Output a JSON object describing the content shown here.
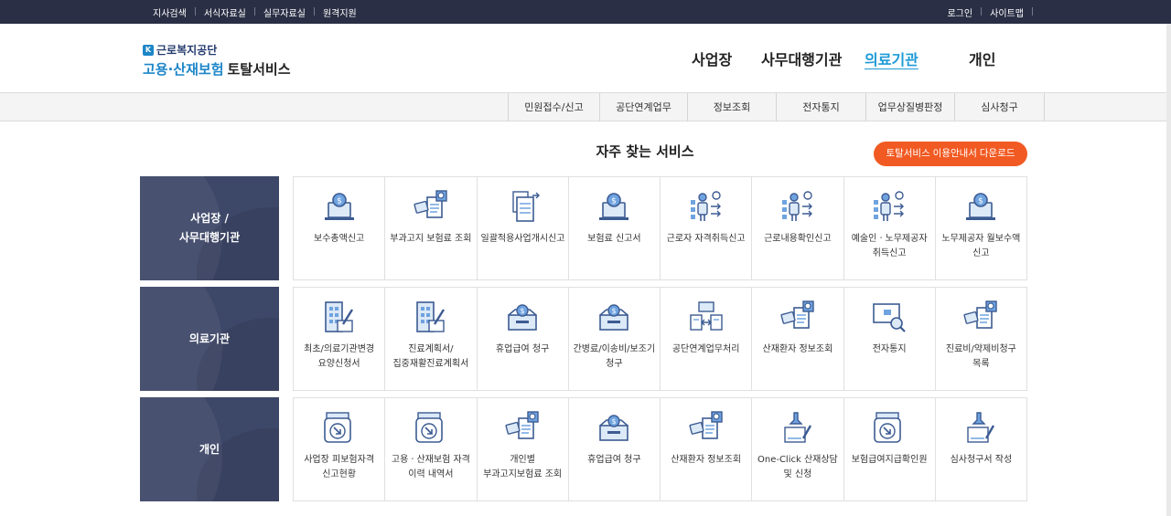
{
  "topbar": {
    "left_links": [
      "지사검색",
      "서식자료실",
      "실무자료실",
      "원격지원"
    ],
    "right_links": [
      "로그인",
      "사이트맵"
    ],
    "separator": "|"
  },
  "logo": {
    "org": "근로복지공단",
    "name_colored": "고용·산재보험",
    "name_dark": "토탈서비스"
  },
  "gnb": [
    "사업장",
    "사무대행기관",
    "의료기관",
    "개인"
  ],
  "gnb_active_index": 2,
  "submenu": [
    "민원접수/신고",
    "공단연계업무",
    "정보조회",
    "전자통지",
    "업무상질병판정",
    "심사청구"
  ],
  "title": "자주 찾는 서비스",
  "download_button": "토탈서비스 이용안내서 다운로드",
  "colors": {
    "accent": "#1d9ad6",
    "category_bg": "#3d4768",
    "button": "#f15a22",
    "topbar": "#2a2f45"
  },
  "rows": [
    {
      "category": [
        "사업장 /",
        "사무대행기관"
      ],
      "tiles": [
        {
          "label": "보수총액신고",
          "icon": "money-laptop-icon"
        },
        {
          "label": "부과고지 보험료 조회",
          "icon": "document-search-icon"
        },
        {
          "label": "일괄적용사업개시신고",
          "icon": "documents-arrow-icon"
        },
        {
          "label": "보험료 신고서",
          "icon": "money-laptop-icon"
        },
        {
          "label": "근로자 자격취득신고",
          "icon": "person-chart-icon"
        },
        {
          "label": "근로내용확인신고",
          "icon": "person-chart-icon"
        },
        {
          "label": "예술인ㆍ노무제공자 취득신고",
          "icon": "person-chart-icon"
        },
        {
          "label": "노무제공자 월보수액 신고",
          "icon": "money-laptop-icon"
        }
      ]
    },
    {
      "category": [
        "의료기관"
      ],
      "tiles": [
        {
          "label": "최초/의료기관변경 요양신청서",
          "icon": "building-pen-icon"
        },
        {
          "label": "진료계획서/집중재활진료계획서",
          "icon": "building-pen-icon"
        },
        {
          "label": "휴업급여 청구",
          "icon": "money-box-icon"
        },
        {
          "label": "간병료/이송비/보조기 청구",
          "icon": "money-box-icon"
        },
        {
          "label": "공단연계업무처리",
          "icon": "exchange-docs-icon"
        },
        {
          "label": "산재환자 정보조회",
          "icon": "document-search-icon"
        },
        {
          "label": "전자통지",
          "icon": "monitor-search-icon"
        },
        {
          "label": "진료비/약제비청구 목록",
          "icon": "document-search-icon"
        }
      ]
    },
    {
      "category": [
        "개인"
      ],
      "tiles": [
        {
          "label": "사업장 피보험자격 신고현황",
          "icon": "tray-arrow-icon"
        },
        {
          "label": "고용ㆍ산재보험 자격 이력 내역서",
          "icon": "tray-arrow-icon"
        },
        {
          "label": "개인별 부과고지보험료 조회",
          "icon": "document-search-icon"
        },
        {
          "label": "휴업급여 청구",
          "icon": "money-box-icon"
        },
        {
          "label": "산재환자 정보조회",
          "icon": "document-search-icon"
        },
        {
          "label": "One-Click 산재상담 및 신청",
          "icon": "stamp-pen-icon"
        },
        {
          "label": "보험급여지급확인원",
          "icon": "tray-arrow-icon"
        },
        {
          "label": "심사청구서 작성",
          "icon": "stamp-pen-icon"
        }
      ]
    }
  ]
}
